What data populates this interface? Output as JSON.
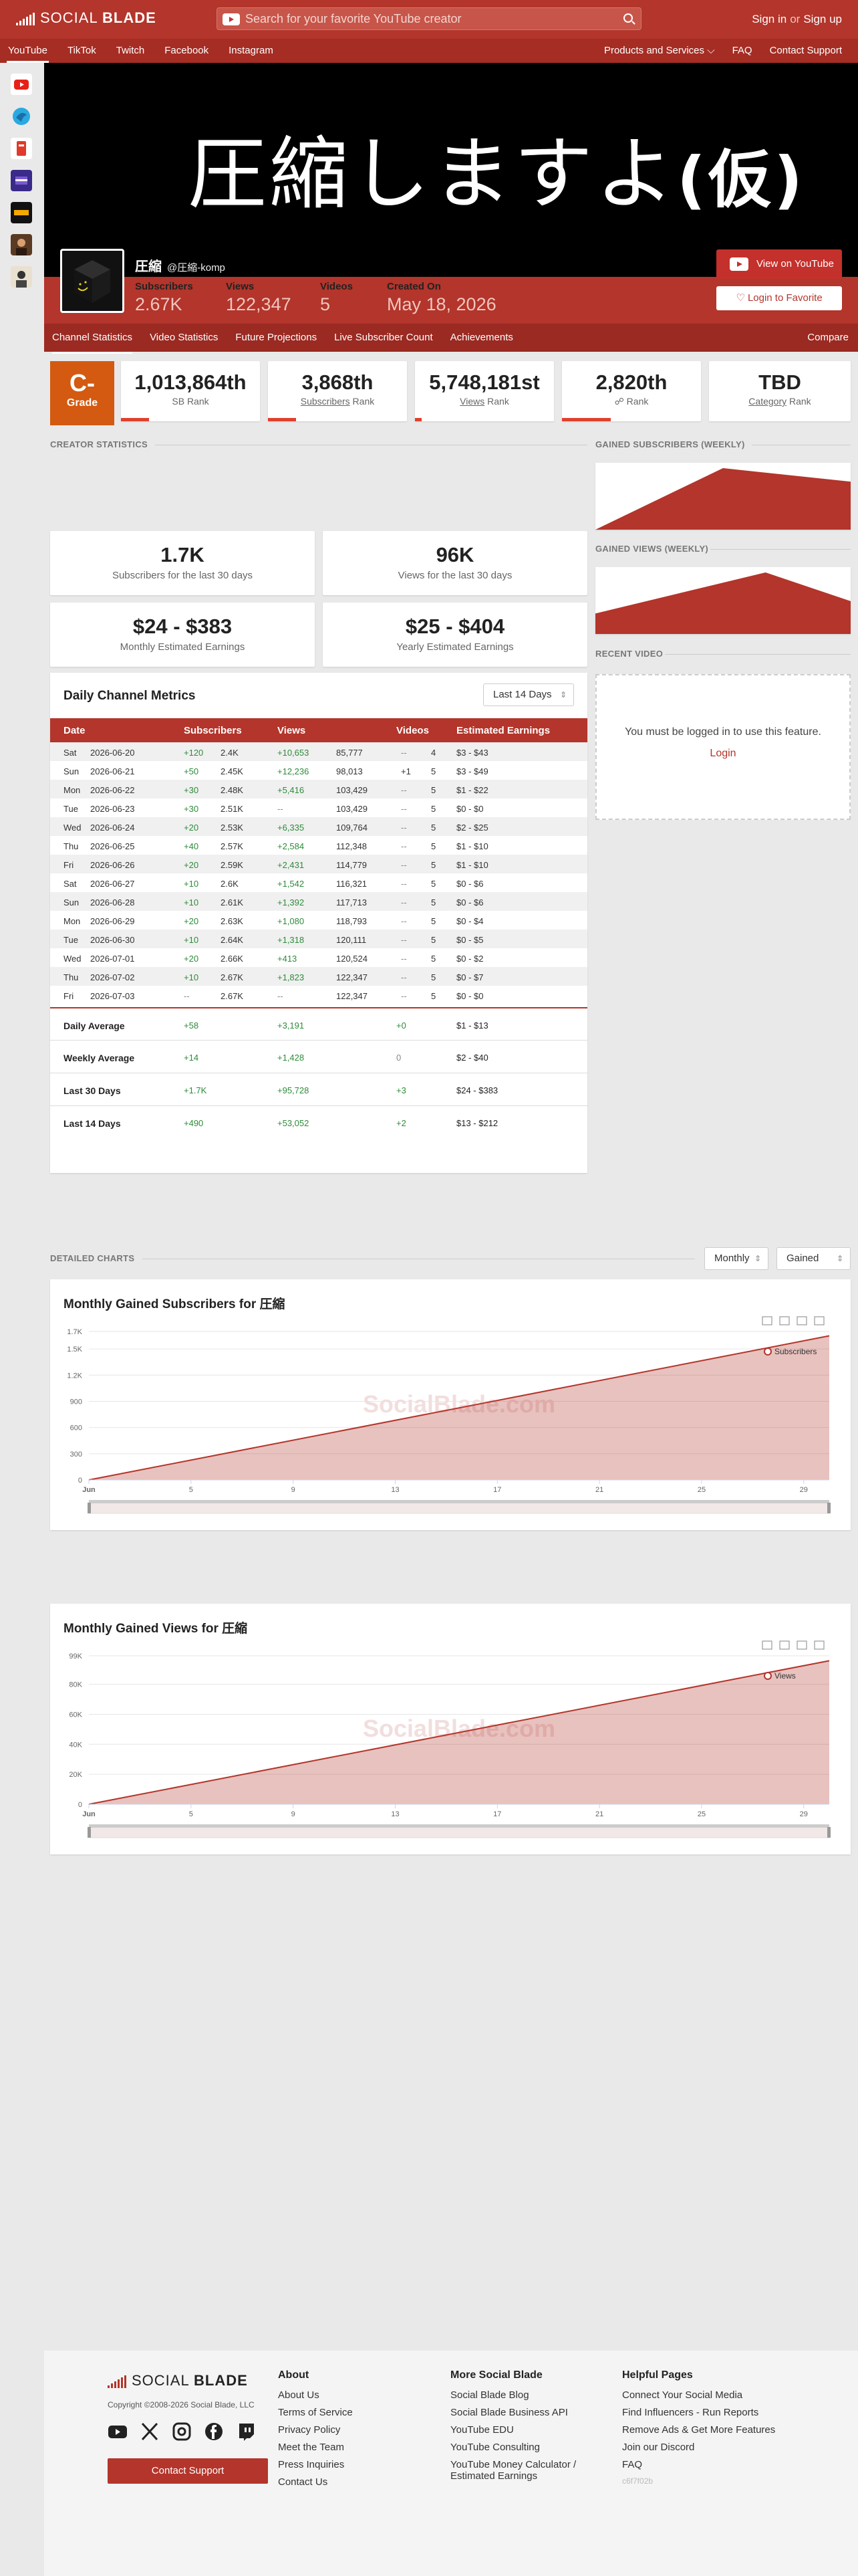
{
  "header": {
    "logo_left": "SOCIAL",
    "logo_right": "BLADE",
    "search_placeholder": "Search for your favorite YouTube creator",
    "signin": "Sign in",
    "or": "or",
    "signup": "Sign up"
  },
  "subnav": {
    "platforms": [
      "YouTube",
      "TikTok",
      "Twitch",
      "Facebook",
      "Instagram"
    ],
    "products": "Products and Services",
    "faq": "FAQ",
    "contact": "Contact Support"
  },
  "banner": {
    "text": "圧縮しますよ",
    "text_bold": "(仮)"
  },
  "channel": {
    "name": "圧縮",
    "handle": "@圧縮-komp",
    "stats": [
      {
        "label": "Subscribers",
        "value": "2.67K"
      },
      {
        "label": "Views",
        "value": "122,347"
      },
      {
        "label": "Videos",
        "value": "5"
      },
      {
        "label": "Created On",
        "value": "May 18, 2026"
      }
    ],
    "btn_view": "View on YouTube",
    "btn_fav": "Login to Favorite"
  },
  "tabs": {
    "items": [
      "Channel Statistics",
      "Video Statistics",
      "Future Projections",
      "Live Subscriber Count",
      "Achievements"
    ],
    "compare": "Compare"
  },
  "ranks": {
    "grade": "C-",
    "grade_label": "Grade",
    "cards": [
      {
        "value": "1,013,864th",
        "label": "SB Rank",
        "bar_color": "#e0402e",
        "bar_fill": 0.2
      },
      {
        "value": "3,868th",
        "label_u": "Subscribers",
        "label_rest": " Rank",
        "bar_color": "#e0402e",
        "bar_fill": 0.2
      },
      {
        "value": "5,748,181st",
        "label_u": "Views",
        "label_rest": " Rank",
        "bar_color": "#e0402e",
        "bar_fill": 0.05
      },
      {
        "value": "2,820th",
        "label_icon": "☍",
        "label_rest": " Rank",
        "bar_color": "#e0402e",
        "bar_fill": 0.35
      },
      {
        "value": "TBD",
        "label_u": "Category",
        "label_rest": " Rank",
        "bar_color": "#e0402e",
        "bar_fill": 0
      }
    ]
  },
  "sections": {
    "creator_stats": "CREATOR STATISTICS",
    "gained_subs_weekly": "GAINED SUBSCRIBERS (WEEKLY)",
    "gained_views_weekly": "GAINED VIEWS (WEEKLY)",
    "recent_video": "RECENT VIDEO",
    "detailed_charts": "DETAILED CHARTS"
  },
  "summary": [
    {
      "value": "1.7K",
      "desc": "Subscribers for the last 30 days"
    },
    {
      "value": "96K",
      "desc": "Views for the last 30 days"
    },
    {
      "value": "$24 - $383",
      "desc": "Monthly Estimated Earnings"
    },
    {
      "value": "$25 - $404",
      "desc": "Yearly Estimated Earnings"
    }
  ],
  "recent_video": {
    "message": "You must be logged in to use this feature.",
    "login": "Login"
  },
  "metrics": {
    "title": "Daily Channel Metrics",
    "range": "Last 14 Days",
    "headers": [
      "Date",
      "Subscribers",
      "Views",
      "Videos",
      "Estimated Earnings"
    ],
    "rows": [
      {
        "day": "Sat",
        "date": "2026-06-20",
        "sub_gain": "+120",
        "subs": "2.4K",
        "view_gain": "+10,653",
        "views": "85,777",
        "vid_gain": "--",
        "vids": "4",
        "earn": "$3 - $43"
      },
      {
        "day": "Sun",
        "date": "2026-06-21",
        "sub_gain": "+50",
        "subs": "2.45K",
        "view_gain": "+12,236",
        "views": "98,013",
        "vid_gain": "+1",
        "vids": "5",
        "earn": "$3 - $49"
      },
      {
        "day": "Mon",
        "date": "2026-06-22",
        "sub_gain": "+30",
        "subs": "2.48K",
        "view_gain": "+5,416",
        "views": "103,429",
        "vid_gain": "--",
        "vids": "5",
        "earn": "$1 - $22"
      },
      {
        "day": "Tue",
        "date": "2026-06-23",
        "sub_gain": "+30",
        "subs": "2.51K",
        "view_gain": "--",
        "views": "103,429",
        "vid_gain": "--",
        "vids": "5",
        "earn": "$0 - $0"
      },
      {
        "day": "Wed",
        "date": "2026-06-24",
        "sub_gain": "+20",
        "subs": "2.53K",
        "view_gain": "+6,335",
        "views": "109,764",
        "vid_gain": "--",
        "vids": "5",
        "earn": "$2 - $25"
      },
      {
        "day": "Thu",
        "date": "2026-06-25",
        "sub_gain": "+40",
        "subs": "2.57K",
        "view_gain": "+2,584",
        "views": "112,348",
        "vid_gain": "--",
        "vids": "5",
        "earn": "$1 - $10"
      },
      {
        "day": "Fri",
        "date": "2026-06-26",
        "sub_gain": "+20",
        "subs": "2.59K",
        "view_gain": "+2,431",
        "views": "114,779",
        "vid_gain": "--",
        "vids": "5",
        "earn": "$1 - $10"
      },
      {
        "day": "Sat",
        "date": "2026-06-27",
        "sub_gain": "+10",
        "subs": "2.6K",
        "view_gain": "+1,542",
        "views": "116,321",
        "vid_gain": "--",
        "vids": "5",
        "earn": "$0 - $6"
      },
      {
        "day": "Sun",
        "date": "2026-06-28",
        "sub_gain": "+10",
        "subs": "2.61K",
        "view_gain": "+1,392",
        "views": "117,713",
        "vid_gain": "--",
        "vids": "5",
        "earn": "$0 - $6"
      },
      {
        "day": "Mon",
        "date": "2026-06-29",
        "sub_gain": "+20",
        "subs": "2.63K",
        "view_gain": "+1,080",
        "views": "118,793",
        "vid_gain": "--",
        "vids": "5",
        "earn": "$0 - $4"
      },
      {
        "day": "Tue",
        "date": "2026-06-30",
        "sub_gain": "+10",
        "subs": "2.64K",
        "view_gain": "+1,318",
        "views": "120,111",
        "vid_gain": "--",
        "vids": "5",
        "earn": "$0 - $5"
      },
      {
        "day": "Wed",
        "date": "2026-07-01",
        "sub_gain": "+20",
        "subs": "2.66K",
        "view_gain": "+413",
        "views": "120,524",
        "vid_gain": "--",
        "vids": "5",
        "earn": "$0 - $2"
      },
      {
        "day": "Thu",
        "date": "2026-07-02",
        "sub_gain": "+10",
        "subs": "2.67K",
        "view_gain": "+1,823",
        "views": "122,347",
        "vid_gain": "--",
        "vids": "5",
        "earn": "$0 - $7"
      },
      {
        "day": "Fri",
        "date": "2026-07-03",
        "sub_gain": "--",
        "subs": "2.67K",
        "view_gain": "--",
        "views": "122,347",
        "vid_gain": "--",
        "vids": "5",
        "earn": "$0 - $0"
      }
    ],
    "averages": [
      {
        "label": "Daily Average",
        "subs": "+58",
        "views": "+3,191",
        "vids": "+0",
        "earn": "$1 - $13"
      },
      {
        "label": "Weekly Average",
        "subs": "+14",
        "views": "+1,428",
        "vids": "0",
        "earn": "$2 - $40"
      },
      {
        "label": "Last 30 Days",
        "subs": "+1.7K",
        "views": "+95,728",
        "vids": "+3",
        "earn": "$24 - $383"
      },
      {
        "label": "Last 14 Days",
        "subs": "+490",
        "views": "+53,052",
        "vids": "+2",
        "earn": "$13 - $212"
      }
    ]
  },
  "detailed": {
    "period": "Monthly",
    "mode": "Gained"
  },
  "chart_data": [
    {
      "type": "area",
      "title": "Monthly Gained Subscribers for 圧縮",
      "watermark": "SocialBlade.com",
      "series": [
        {
          "name": "Subscribers",
          "x": [
            1,
            30
          ],
          "values": [
            0,
            1650
          ]
        }
      ],
      "x_ticks": [
        "Jun",
        "5",
        "9",
        "13",
        "17",
        "21",
        "25",
        "29"
      ],
      "x_tick_values": [
        1,
        5,
        9,
        13,
        17,
        21,
        25,
        29
      ],
      "y_ticks": [
        "0",
        "300",
        "600",
        "900",
        "1.2K",
        "1.5K",
        "1.7K"
      ],
      "y_tick_values": [
        0,
        300,
        600,
        900,
        1200,
        1500,
        1700
      ],
      "ylim": [
        0,
        1700
      ],
      "xlim": [
        1,
        30
      ],
      "color": "#b3352b",
      "legend": "top-right",
      "grid": true
    },
    {
      "type": "area",
      "title": "Monthly Gained Views for 圧縮",
      "watermark": "SocialBlade.com",
      "series": [
        {
          "name": "Views",
          "x": [
            1,
            30
          ],
          "values": [
            0,
            95728
          ]
        }
      ],
      "x_ticks": [
        "Jun",
        "5",
        "9",
        "13",
        "17",
        "21",
        "25",
        "29"
      ],
      "x_tick_values": [
        1,
        5,
        9,
        13,
        17,
        21,
        25,
        29
      ],
      "y_ticks": [
        "0",
        "20K",
        "40K",
        "60K",
        "80K",
        "99K"
      ],
      "y_tick_values": [
        0,
        20000,
        40000,
        60000,
        80000,
        99000
      ],
      "ylim": [
        0,
        99000
      ],
      "xlim": [
        1,
        30
      ],
      "color": "#b3352b",
      "legend": "top-right",
      "grid": true
    }
  ],
  "weekly_subs": {
    "values": [
      0,
      1000,
      780
    ]
  },
  "weekly_views": {
    "values": [
      1000,
      2000,
      3000,
      1600
    ]
  },
  "footer": {
    "logo_left": "SOCIAL",
    "logo_right": "BLADE",
    "copyright": "Copyright ©2008-2026 Social Blade, LLC",
    "contact_btn": "Contact Support",
    "about_title": "About",
    "about": [
      "About Us",
      "Terms of Service",
      "Privacy Policy",
      "Meet the Team",
      "Press Inquiries",
      "Contact Us"
    ],
    "more_title": "More Social Blade",
    "more": [
      "Social Blade Blog",
      "Social Blade Business API",
      "YouTube EDU",
      "YouTube Consulting",
      "YouTube Money Calculator / Estimated Earnings"
    ],
    "help_title": "Helpful Pages",
    "help": [
      "Connect Your Social Media",
      "Find Influencers - Run Reports",
      "Remove Ads & Get More Features",
      "Join our Discord",
      "FAQ"
    ],
    "build": "c6f7f02b"
  }
}
